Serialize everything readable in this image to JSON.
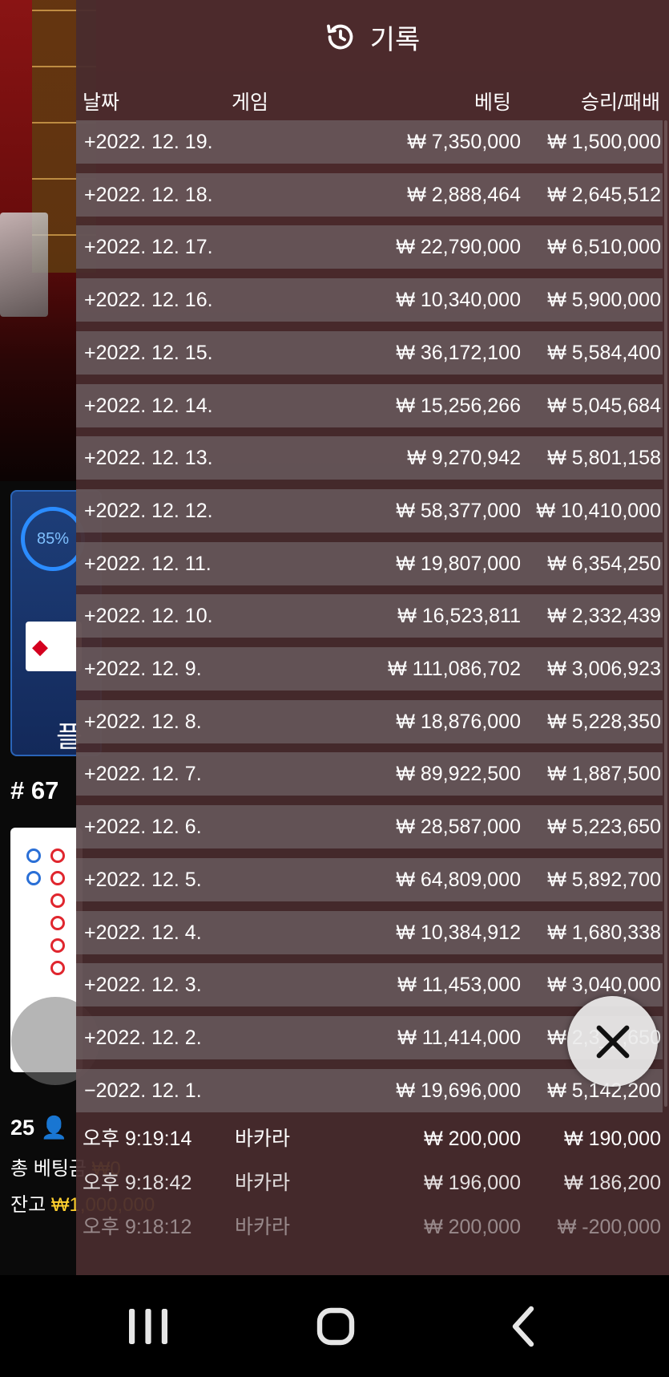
{
  "header": {
    "title": "기록",
    "icon": "history-icon"
  },
  "columns": {
    "date": "날짜",
    "game": "게임",
    "bet": "베팅",
    "result": "승리/패배"
  },
  "daily_rows": [
    {
      "date": "+2022. 12. 19.",
      "bet": "₩ 7,350,000",
      "win": "₩ 1,500,000"
    },
    {
      "date": "+2022. 12. 18.",
      "bet": "₩ 2,888,464",
      "win": "₩ 2,645,512"
    },
    {
      "date": "+2022. 12. 17.",
      "bet": "₩ 22,790,000",
      "win": "₩ 6,510,000"
    },
    {
      "date": "+2022. 12. 16.",
      "bet": "₩ 10,340,000",
      "win": "₩ 5,900,000"
    },
    {
      "date": "+2022. 12. 15.",
      "bet": "₩ 36,172,100",
      "win": "₩ 5,584,400"
    },
    {
      "date": "+2022. 12. 14.",
      "bet": "₩ 15,256,266",
      "win": "₩ 5,045,684"
    },
    {
      "date": "+2022. 12. 13.",
      "bet": "₩ 9,270,942",
      "win": "₩ 5,801,158"
    },
    {
      "date": "+2022. 12. 12.",
      "bet": "₩ 58,377,000",
      "win": "₩ 10,410,000"
    },
    {
      "date": "+2022. 12. 11.",
      "bet": "₩ 19,807,000",
      "win": "₩ 6,354,250"
    },
    {
      "date": "+2022. 12. 10.",
      "bet": "₩ 16,523,811",
      "win": "₩ 2,332,439"
    },
    {
      "date": "+2022. 12. 9.",
      "bet": "₩ 111,086,702",
      "win": "₩ 3,006,923"
    },
    {
      "date": "+2022. 12. 8.",
      "bet": "₩ 18,876,000",
      "win": "₩ 5,228,350"
    },
    {
      "date": "+2022. 12. 7.",
      "bet": "₩ 89,922,500",
      "win": "₩ 1,887,500"
    },
    {
      "date": "+2022. 12. 6.",
      "bet": "₩ 28,587,000",
      "win": "₩ 5,223,650"
    },
    {
      "date": "+2022. 12. 5.",
      "bet": "₩ 64,809,000",
      "win": "₩ 5,892,700"
    },
    {
      "date": "+2022. 12. 4.",
      "bet": "₩ 10,384,912",
      "win": "₩ 1,680,338"
    },
    {
      "date": "+2022. 12. 3.",
      "bet": "₩ 11,453,000",
      "win": "₩ 3,040,000"
    },
    {
      "date": "+2022. 12. 2.",
      "bet": "₩ 11,414,000",
      "win": "₩ 2,3__,650"
    },
    {
      "date": "−2022. 12. 1.",
      "bet": "₩ 19,696,000",
      "win": "₩ 5,142,200"
    }
  ],
  "detail_rows": [
    {
      "time": "오후 9:19:14",
      "game": "바카라",
      "bet": "₩ 200,000",
      "win": "₩ 190,000"
    },
    {
      "time": "오후 9:18:42",
      "game": "바카라",
      "bet": "₩ 196,000",
      "win": "₩ 186,200"
    },
    {
      "time": "오후 9:18:12",
      "game": "바카라",
      "bet": "₩ 200,000",
      "win": "₩ -200,000"
    }
  ],
  "background": {
    "stat_percent": "85%",
    "stat_button": "플",
    "round": "# 67",
    "players": "25",
    "total_bet_label": "총 베팅금",
    "total_bet_value": "₩0",
    "balance_label": "잔고",
    "balance_value": "₩1,000,000"
  },
  "colors": {
    "panel_bg": "#482c2e",
    "row_bg": "#736a6c",
    "close_bg": "#ebebeb",
    "accent_blue": "#2b8cff"
  }
}
